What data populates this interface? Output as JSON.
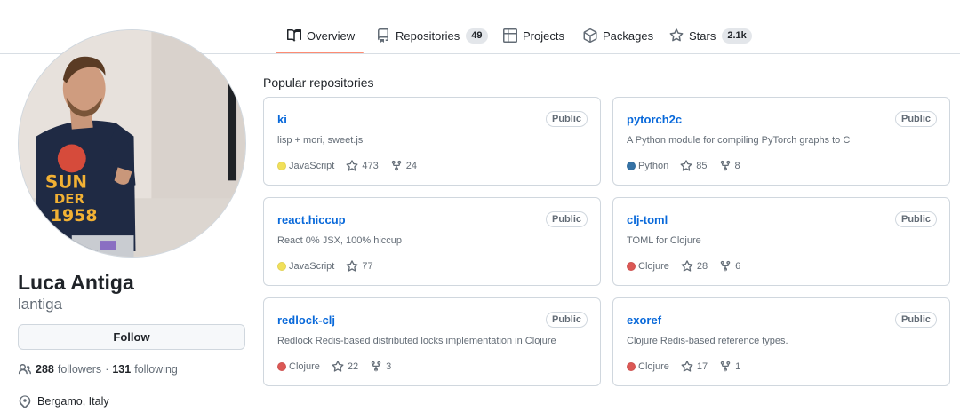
{
  "nav": {
    "tabs": [
      {
        "label": "Overview",
        "icon": "book-icon",
        "count": ""
      },
      {
        "label": "Repositories",
        "icon": "repo-icon",
        "count": "49"
      },
      {
        "label": "Projects",
        "icon": "table-icon",
        "count": ""
      },
      {
        "label": "Packages",
        "icon": "package-icon",
        "count": ""
      },
      {
        "label": "Stars",
        "icon": "star-icon",
        "count": "2.1k"
      }
    ],
    "active_tab": "Overview"
  },
  "profile": {
    "fullname": "Luca Antiga",
    "username": "lantiga",
    "follow_label": "Follow",
    "followers_count": "288",
    "followers_label": "followers",
    "separator": "·",
    "following_count": "131",
    "following_label": "following",
    "location": "Bergamo, Italy",
    "shirt_text_1": "SUN",
    "shirt_text_2": "DER",
    "shirt_text_3": "1958"
  },
  "popular": {
    "title": "Popular repositories",
    "repos": [
      {
        "name": "ki",
        "visibility": "Public",
        "description": "lisp + mori, sweet.js",
        "language": "JavaScript",
        "lang_color": "#f1e05a",
        "stars": "473",
        "forks": "24"
      },
      {
        "name": "pytorch2c",
        "visibility": "Public",
        "description": "A Python module for compiling PyTorch graphs to C",
        "language": "Python",
        "lang_color": "#3572A5",
        "stars": "85",
        "forks": "8"
      },
      {
        "name": "react.hiccup",
        "visibility": "Public",
        "description": "React 0% JSX, 100% hiccup",
        "language": "JavaScript",
        "lang_color": "#f1e05a",
        "stars": "77",
        "forks": ""
      },
      {
        "name": "clj-toml",
        "visibility": "Public",
        "description": "TOML for Clojure",
        "language": "Clojure",
        "lang_color": "#db5855",
        "stars": "28",
        "forks": "6"
      },
      {
        "name": "redlock-clj",
        "visibility": "Public",
        "description": "Redlock Redis-based distributed locks implementation in Clojure",
        "language": "Clojure",
        "lang_color": "#db5855",
        "stars": "22",
        "forks": "3"
      },
      {
        "name": "exoref",
        "visibility": "Public",
        "description": "Clojure Redis-based reference types.",
        "language": "Clojure",
        "lang_color": "#db5855",
        "stars": "17",
        "forks": "1"
      }
    ]
  },
  "colors": {
    "link": "#0969da",
    "muted": "#636c76",
    "border": "#d0d7de",
    "tab_underline": "#fd8c73"
  }
}
